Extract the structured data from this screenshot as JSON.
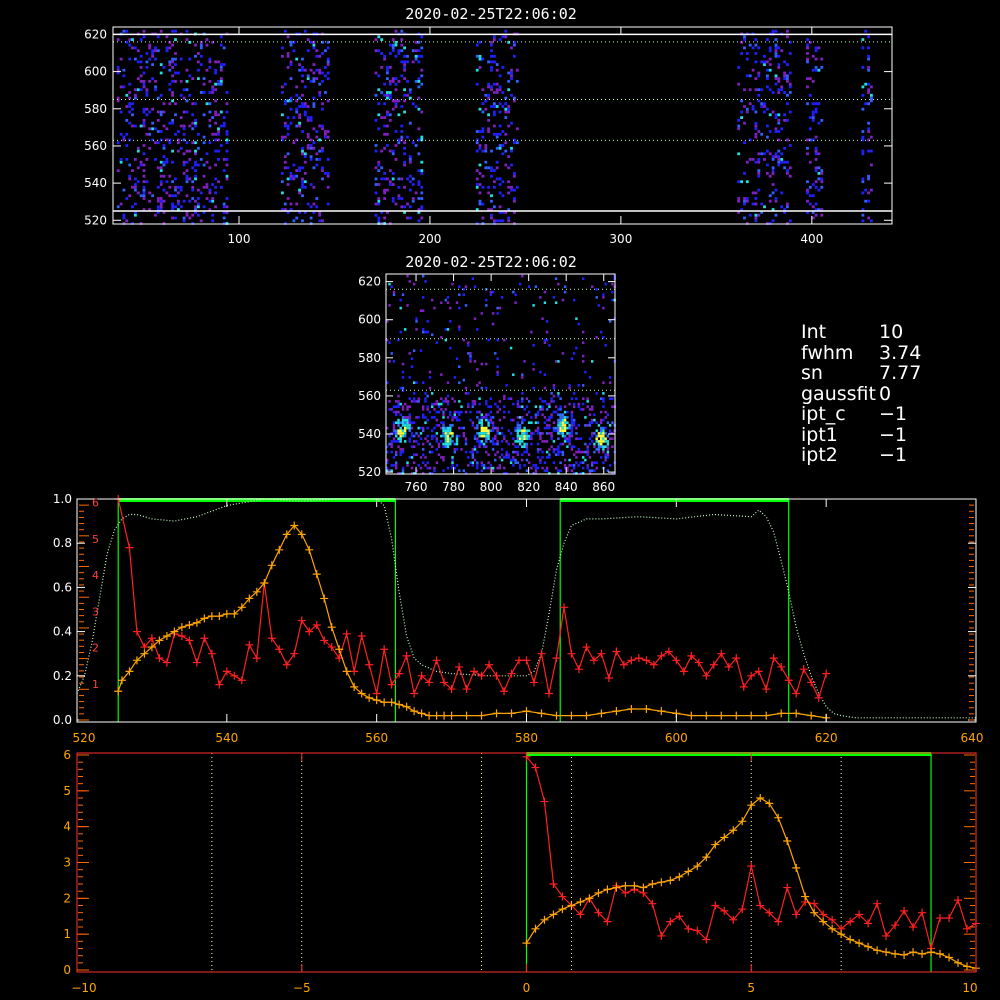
{
  "colors": {
    "background": "#000000",
    "axis": "#ffffff",
    "green": "#00ff00",
    "red": "#ff2020",
    "orange": "#ffa500",
    "dotted_green": "#c8ffc8",
    "dotted_yellow": "#ffff99",
    "blue": "#2020ff",
    "purple": "#8020c0",
    "cyan": "#20e0e0"
  },
  "info": {
    "rows": [
      {
        "key": "Int",
        "val": "10"
      },
      {
        "key": "fwhm",
        "val": "3.74"
      },
      {
        "key": "sn",
        "val": "7.77"
      },
      {
        "key": "gaussfit",
        "val": "0"
      },
      {
        "key": "ipt_c",
        "val": "−1"
      },
      {
        "key": "ipt1",
        "val": "−1"
      },
      {
        "key": "ipt2",
        "val": "−1"
      }
    ]
  },
  "chart_data": [
    {
      "type": "heatmap",
      "title": "2020-02-25T22:06:02",
      "xlim": [
        34,
        442
      ],
      "ylim": [
        518,
        624
      ],
      "xticks": [
        100,
        200,
        300,
        400
      ],
      "yticks": [
        520,
        540,
        560,
        580,
        600,
        620
      ],
      "hlines_solid": [
        525,
        620
      ],
      "hlines_dotted": [
        563,
        585,
        616
      ],
      "bands": [
        [
          36,
          94
        ],
        [
          122,
          147
        ],
        [
          171,
          196
        ],
        [
          224,
          246
        ],
        [
          361,
          389
        ],
        [
          397,
          405
        ],
        [
          426,
          432
        ]
      ]
    },
    {
      "type": "heatmap",
      "title": "2020-02-25T22:06:02",
      "xlim": [
        744,
        866
      ],
      "ylim": [
        519,
        624
      ],
      "xticks": [
        760,
        780,
        800,
        820,
        840,
        860
      ],
      "yticks": [
        520,
        540,
        560,
        580,
        600,
        620
      ],
      "hlines_dotted": [
        563,
        590,
        616
      ],
      "hotspots": [
        [
          752,
          543
        ],
        [
          777,
          540
        ],
        [
          796,
          542
        ],
        [
          816,
          540
        ],
        [
          838,
          545
        ],
        [
          858,
          538
        ]
      ]
    },
    {
      "type": "line",
      "xlim": [
        520,
        640
      ],
      "ylim": [
        0,
        1.0
      ],
      "xticks": [
        520,
        540,
        560,
        580,
        600,
        620,
        640
      ],
      "yticks_left": [
        "0.0",
        "0.2",
        "0.4",
        "0.6",
        "0.8",
        "1.0"
      ],
      "red_axis_ticks": [
        "1",
        "2",
        "3",
        "4",
        "5",
        "6"
      ],
      "green_windows": [
        [
          525.5,
          562.5
        ],
        [
          584.5,
          615.0
        ]
      ],
      "series": [
        {
          "color": "red",
          "x": [
            525.5,
            527,
            528,
            529,
            530,
            531,
            532,
            533,
            534,
            535,
            536,
            537,
            538,
            539,
            540,
            541,
            542,
            543,
            544,
            545,
            546,
            547,
            548,
            549,
            550,
            551,
            552,
            553,
            554,
            555,
            556,
            557,
            558,
            559,
            560,
            561,
            562,
            563,
            564,
            565,
            566,
            567,
            568,
            569,
            570,
            571,
            572,
            573,
            574,
            575,
            576,
            577,
            578,
            579,
            580,
            581,
            582,
            583,
            584,
            585,
            586,
            587,
            588,
            589,
            590,
            591,
            592,
            593,
            594,
            595,
            596,
            597,
            598,
            599,
            600,
            601,
            602,
            603,
            604,
            605,
            606,
            607,
            608,
            609,
            610,
            611,
            612,
            613,
            614,
            615,
            616,
            617,
            618,
            619,
            620
          ],
          "y": [
            1.0,
            0.78,
            0.4,
            0.33,
            0.37,
            0.28,
            0.26,
            0.39,
            0.38,
            0.36,
            0.26,
            0.37,
            0.3,
            0.16,
            0.22,
            0.2,
            0.18,
            0.34,
            0.28,
            0.62,
            0.37,
            0.32,
            0.25,
            0.3,
            0.45,
            0.4,
            0.43,
            0.36,
            0.33,
            0.28,
            0.39,
            0.22,
            0.38,
            0.25,
            0.12,
            0.32,
            0.16,
            0.21,
            0.29,
            0.12,
            0.2,
            0.17,
            0.27,
            0.17,
            0.14,
            0.24,
            0.14,
            0.22,
            0.2,
            0.25,
            0.2,
            0.13,
            0.21,
            0.27,
            0.27,
            0.17,
            0.3,
            0.12,
            0.28,
            0.51,
            0.3,
            0.23,
            0.33,
            0.27,
            0.3,
            0.19,
            0.31,
            0.25,
            0.27,
            0.28,
            0.27,
            0.25,
            0.29,
            0.31,
            0.27,
            0.22,
            0.29,
            0.26,
            0.2,
            0.25,
            0.3,
            0.24,
            0.28,
            0.15,
            0.2,
            0.22,
            0.14,
            0.28,
            0.24,
            0.18,
            0.12,
            0.23,
            0.17,
            0.1,
            0.21
          ]
        },
        {
          "color": "orange",
          "x": [
            525.5,
            526,
            527,
            528,
            529,
            530,
            531,
            532,
            533,
            534,
            535,
            536,
            537,
            538,
            539,
            540,
            541,
            542,
            543,
            544,
            545,
            546,
            547,
            548,
            549,
            550,
            551,
            552,
            553,
            554,
            555,
            556,
            557,
            558,
            559,
            560,
            561,
            562,
            563,
            564,
            565,
            566,
            567,
            568,
            569,
            570,
            572,
            574,
            576,
            578,
            580,
            582,
            584,
            586,
            588,
            590,
            592,
            594,
            596,
            598,
            600,
            602,
            604,
            606,
            608,
            610,
            612,
            614,
            616,
            618,
            620
          ],
          "y": [
            0.13,
            0.18,
            0.22,
            0.27,
            0.3,
            0.33,
            0.36,
            0.38,
            0.4,
            0.42,
            0.43,
            0.44,
            0.46,
            0.47,
            0.47,
            0.48,
            0.48,
            0.51,
            0.55,
            0.58,
            0.62,
            0.7,
            0.77,
            0.84,
            0.88,
            0.84,
            0.77,
            0.66,
            0.55,
            0.42,
            0.32,
            0.22,
            0.15,
            0.12,
            0.1,
            0.09,
            0.08,
            0.08,
            0.07,
            0.06,
            0.04,
            0.03,
            0.02,
            0.02,
            0.02,
            0.02,
            0.02,
            0.02,
            0.03,
            0.03,
            0.04,
            0.03,
            0.02,
            0.02,
            0.02,
            0.03,
            0.04,
            0.05,
            0.05,
            0.04,
            0.03,
            0.02,
            0.02,
            0.02,
            0.02,
            0.02,
            0.02,
            0.03,
            0.03,
            0.02,
            0.01
          ]
        },
        {
          "color": "dotted_green",
          "x": [
            520,
            521,
            522,
            523,
            524,
            525,
            526,
            527,
            528,
            530,
            533,
            536,
            540,
            545,
            550,
            555,
            560,
            561,
            562,
            563,
            564,
            565,
            566,
            568,
            570,
            575,
            580,
            581,
            582,
            583,
            584,
            585,
            586,
            588,
            590,
            595,
            600,
            605,
            610,
            611,
            612,
            613,
            614,
            615,
            616,
            617,
            618,
            619,
            620,
            621,
            622,
            624,
            628,
            632,
            636,
            640
          ],
          "y": [
            0.12,
            0.2,
            0.35,
            0.55,
            0.75,
            0.86,
            0.91,
            0.93,
            0.93,
            0.91,
            0.9,
            0.92,
            0.97,
            1.0,
            0.99,
            1.0,
            1.0,
            0.97,
            0.82,
            0.58,
            0.38,
            0.28,
            0.25,
            0.22,
            0.21,
            0.2,
            0.2,
            0.22,
            0.3,
            0.48,
            0.68,
            0.8,
            0.88,
            0.91,
            0.91,
            0.92,
            0.91,
            0.93,
            0.92,
            0.95,
            0.92,
            0.85,
            0.72,
            0.58,
            0.42,
            0.3,
            0.2,
            0.12,
            0.06,
            0.03,
            0.02,
            0.01,
            0.01,
            0.01,
            0.01,
            0.01
          ]
        }
      ]
    },
    {
      "type": "line",
      "xlim": [
        -10,
        10
      ],
      "ylim": [
        0,
        6
      ],
      "xticks": [
        -10,
        -5,
        0,
        5,
        10
      ],
      "yticks_left": [
        "0",
        "1",
        "2",
        "3",
        "4",
        "5",
        "6"
      ],
      "green_window": [
        0,
        9
      ],
      "vlines_dotted": [
        -7,
        -5,
        -1,
        1,
        5,
        7
      ],
      "series": [
        {
          "color": "red",
          "x": [
            0,
            0.2,
            0.4,
            0.6,
            0.8,
            1.0,
            1.2,
            1.4,
            1.6,
            1.8,
            2.0,
            2.2,
            2.4,
            2.6,
            2.8,
            3.0,
            3.2,
            3.4,
            3.6,
            3.8,
            4.0,
            4.2,
            4.4,
            4.6,
            4.8,
            5.0,
            5.2,
            5.4,
            5.6,
            5.8,
            6.0,
            6.2,
            6.4,
            6.6,
            6.8,
            7.0,
            7.2,
            7.4,
            7.6,
            7.8,
            8.0,
            8.2,
            8.4,
            8.6,
            8.8,
            9.0,
            9.2,
            9.4,
            9.6,
            9.8,
            10.0
          ],
          "y": [
            5.95,
            5.65,
            4.7,
            2.4,
            2.05,
            1.8,
            1.55,
            2.0,
            1.6,
            1.35,
            2.35,
            2.15,
            2.25,
            2.15,
            1.85,
            0.95,
            1.35,
            1.5,
            1.15,
            1.1,
            0.85,
            1.8,
            1.65,
            1.4,
            1.7,
            2.9,
            1.8,
            1.6,
            1.35,
            2.3,
            1.55,
            1.9,
            1.85,
            1.55,
            1.4,
            1.15,
            1.35,
            1.55,
            1.3,
            1.85,
            0.95,
            1.25,
            1.65,
            1.2,
            1.6,
            0.6,
            1.45,
            1.45,
            1.95,
            1.15,
            1.3
          ]
        },
        {
          "color": "orange",
          "x": [
            0,
            0.2,
            0.4,
            0.6,
            0.8,
            1.0,
            1.2,
            1.4,
            1.6,
            1.8,
            2.0,
            2.2,
            2.4,
            2.6,
            2.8,
            3.0,
            3.2,
            3.4,
            3.6,
            3.8,
            4.0,
            4.2,
            4.4,
            4.6,
            4.8,
            5.0,
            5.2,
            5.4,
            5.6,
            5.8,
            6.0,
            6.2,
            6.4,
            6.6,
            6.8,
            7.0,
            7.2,
            7.4,
            7.6,
            7.8,
            8.0,
            8.2,
            8.4,
            8.6,
            8.8,
            9.0,
            9.2,
            9.4,
            9.6,
            9.8,
            10.0
          ],
          "y": [
            0.75,
            1.15,
            1.4,
            1.55,
            1.7,
            1.8,
            1.9,
            2.0,
            2.15,
            2.25,
            2.3,
            2.35,
            2.35,
            2.3,
            2.4,
            2.45,
            2.5,
            2.6,
            2.75,
            2.9,
            3.15,
            3.5,
            3.7,
            3.9,
            4.15,
            4.6,
            4.8,
            4.65,
            4.25,
            3.6,
            2.85,
            2.05,
            1.6,
            1.35,
            1.15,
            1.0,
            0.85,
            0.75,
            0.65,
            0.55,
            0.5,
            0.45,
            0.42,
            0.5,
            0.45,
            0.5,
            0.45,
            0.35,
            0.2,
            0.1,
            0.05
          ]
        }
      ]
    }
  ]
}
